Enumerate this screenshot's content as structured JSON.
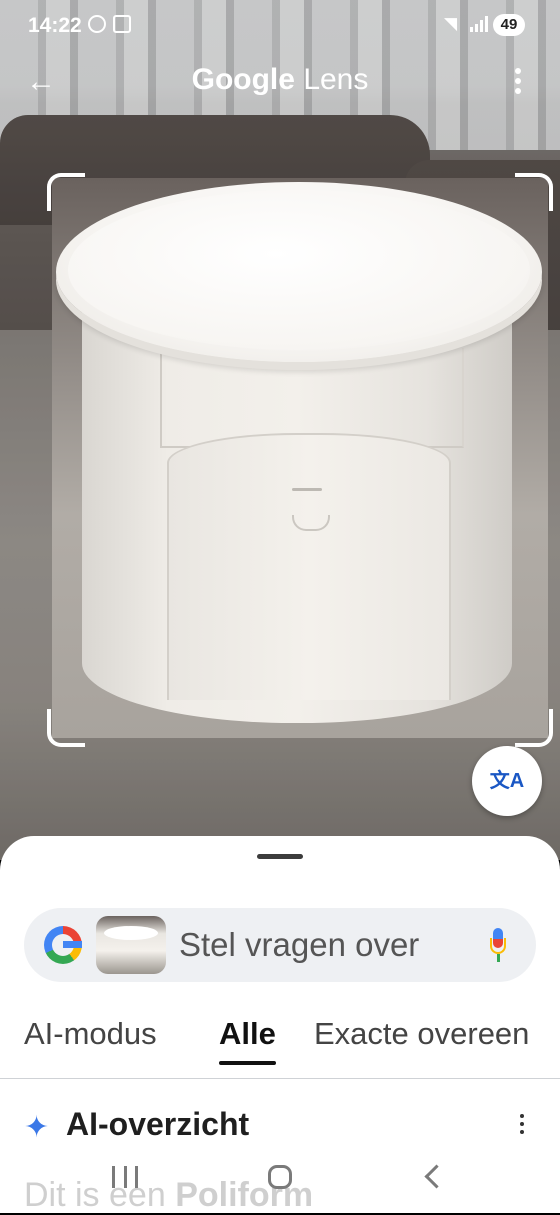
{
  "status_bar": {
    "time": "14:22",
    "battery": "49"
  },
  "top_bar": {
    "title_google": "Google",
    "title_lens": "Lens"
  },
  "search": {
    "placeholder": "Stel vragen over"
  },
  "tabs": [
    {
      "label": "AI-modus"
    },
    {
      "label": "Alle"
    },
    {
      "label": "Exacte overeen"
    }
  ],
  "ai_overview": {
    "title": "AI-overzicht",
    "text_start": "Dit is een ",
    "text_bold": "Poliform"
  },
  "icons": {
    "back": "arrow-left-icon",
    "more": "more-vertical-icon",
    "translate": "translate-icon",
    "google": "google-g-icon",
    "mic": "microphone-icon",
    "sparkle": "sparkle-icon"
  },
  "colors": {
    "accent_blue": "#3b78e7",
    "translate_blue": "#1a57c4"
  }
}
